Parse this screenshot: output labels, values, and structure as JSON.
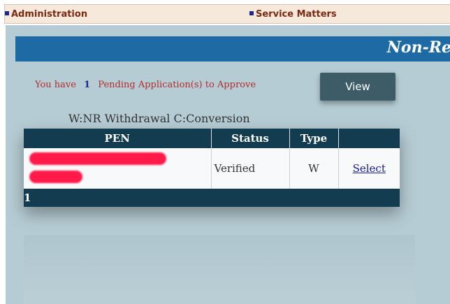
{
  "menu": {
    "administration": "Administration",
    "service_matters": "Service Matters"
  },
  "banner": {
    "title": "Non-Re"
  },
  "pending": {
    "prefix": "You have",
    "count": "1",
    "suffix": "Pending Application(s) to Approve"
  },
  "view_button": "View",
  "legend": "W:NR Withdrawal   C:Conversion",
  "table": {
    "headers": [
      "PEN",
      "Status",
      "Type",
      ""
    ],
    "rows": [
      {
        "pen": "",
        "status": "Verified",
        "type": "W",
        "action": "Select"
      }
    ],
    "footer": "1"
  },
  "colors": {
    "banner": "#1e6aa4",
    "header": "#143c50",
    "button": "#3e5c68",
    "page_bg": "#b6ccd4",
    "alert_text": "#b22b2b"
  }
}
